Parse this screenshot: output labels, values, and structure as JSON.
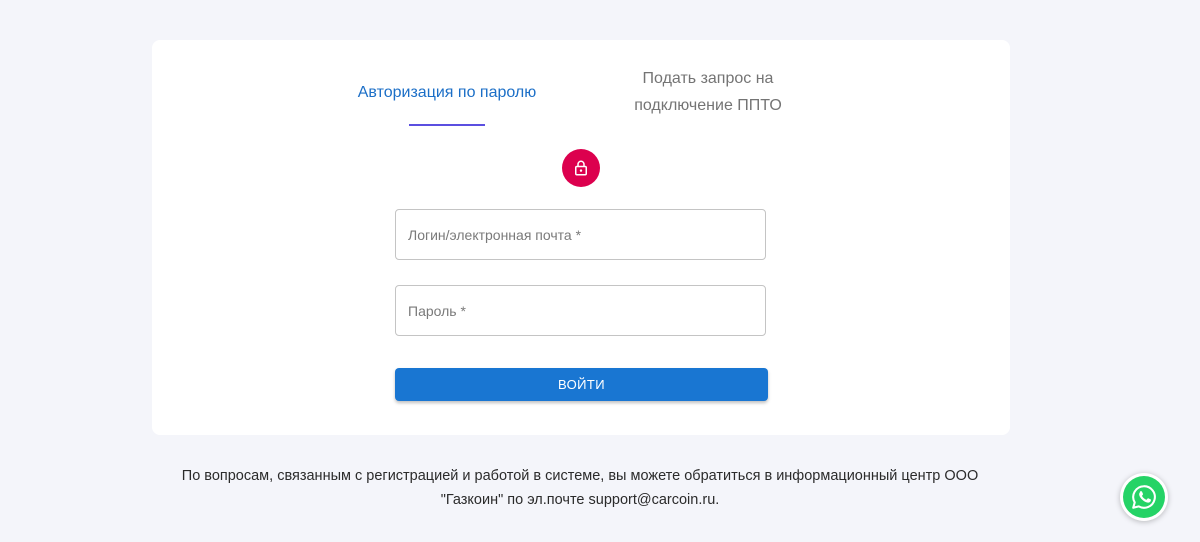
{
  "tabs": {
    "password_login": "Авторизация по паролю",
    "request_line1": "Подать запрос на",
    "request_line2": "подключение ППТО"
  },
  "form": {
    "login_placeholder": "Логин/электронная почта *",
    "password_placeholder": "Пароль *",
    "submit_label": "ВОЙТИ"
  },
  "footer": {
    "line1": "По вопросам, связанным с регистрацией и работой в системе, вы можете обратиться в информационный центр ООО",
    "line2": "\"Газкоин\" по эл.почте support@carcoin.ru."
  },
  "icons": {
    "lock": "lock-icon",
    "whatsapp": "whatsapp-icon"
  },
  "colors": {
    "accent": "#1976d2",
    "active_tab": "#1c6fc7",
    "tab_indicator": "#5b4fe0",
    "lock_avatar": "#dc004e",
    "whatsapp": "#25d366",
    "background": "#f4f5fa"
  }
}
